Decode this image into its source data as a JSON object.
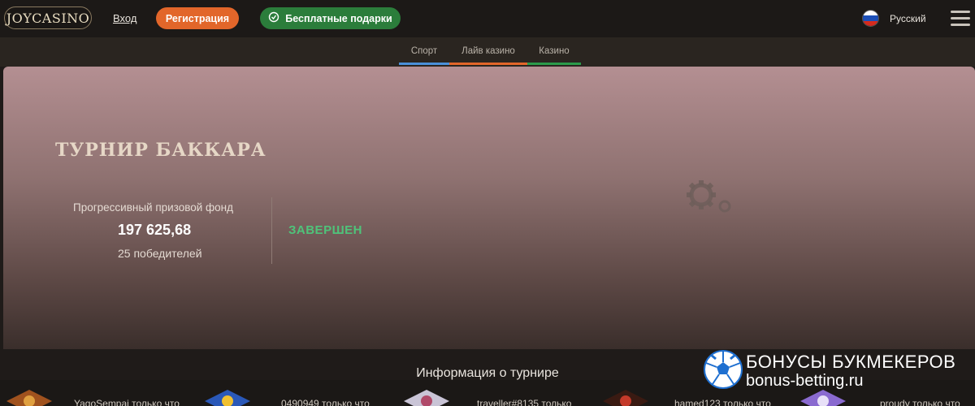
{
  "header": {
    "logo": "JOYCASINO",
    "login_label": "Вход",
    "register_label": "Регистрация",
    "gifts_label": "Бесплатные подарки",
    "language_label": "Русский"
  },
  "subnav": {
    "tabs": [
      {
        "label": "Спорт",
        "color": "#4a90d9"
      },
      {
        "label": "Лайв казино",
        "color": "#e2662a"
      },
      {
        "label": "Казино",
        "color": "#2b9a4a"
      }
    ]
  },
  "banner": {
    "title": "ТУРНИР БАККАРА",
    "prize_label": "Прогрессивный призовой фонд",
    "prize_amount": "197 625,68",
    "winners": "25 победителей",
    "status": "ЗАВЕРШЕН"
  },
  "info_title": "Информация о турнире",
  "ticker": [
    {
      "text": "YagoSempai только что"
    },
    {
      "text": "0490949 только что"
    },
    {
      "text": "traveller#8135 только"
    },
    {
      "text": "hamed123 только что"
    },
    {
      "text": "proudy только что"
    }
  ],
  "watermark": {
    "line1": "БОНУСЫ БУКМЕКЕРОВ",
    "line2": "bonus-betting.ru"
  },
  "colors": {
    "accent_orange": "#e2662a",
    "accent_green": "#2b7d3b",
    "status_green": "#4fc37a"
  }
}
